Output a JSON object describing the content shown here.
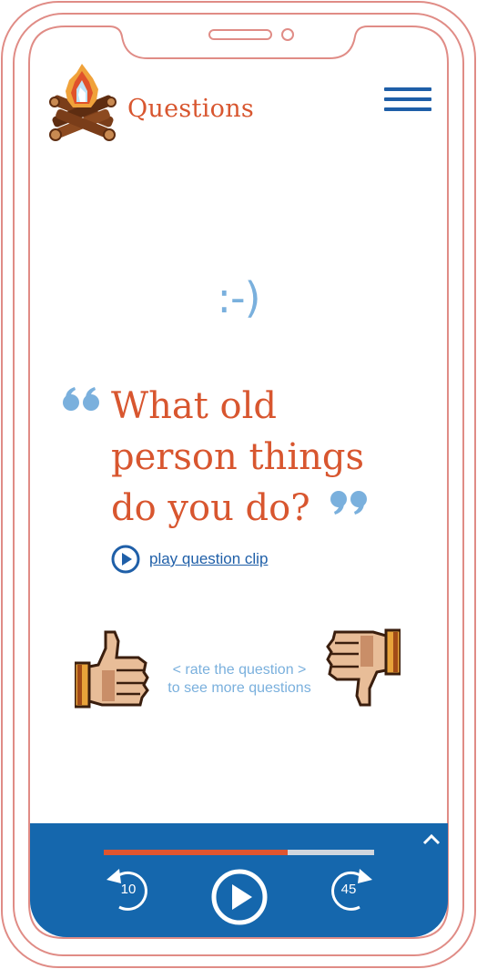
{
  "header": {
    "title": "Questions"
  },
  "main": {
    "emoticon": ":-)",
    "question": "What old person things do you do?",
    "play_clip_label": "play question clip",
    "rate_line1": "< rate the question >",
    "rate_line2": "to see more questions"
  },
  "player": {
    "progress": 0.68,
    "rewind_seconds": "10",
    "forward_seconds": "45"
  },
  "colors": {
    "accent_orange": "#d8562f",
    "brand_blue": "#1f5fa8",
    "player_blue": "#1567ad",
    "light_blue": "#7ab0dd",
    "frame_pink": "#e08c86"
  },
  "icons": {
    "logo": "campfire-icon",
    "menu": "hamburger-menu-icon",
    "open_quote": "open-quote-icon",
    "close_quote": "close-quote-icon",
    "play_clip": "play-circle-icon",
    "like": "thumbs-up-icon",
    "dislike": "thumbs-down-icon",
    "collapse": "chevron-up-icon",
    "rewind": "rewind-icon",
    "play": "play-icon",
    "forward": "fast-forward-icon"
  }
}
